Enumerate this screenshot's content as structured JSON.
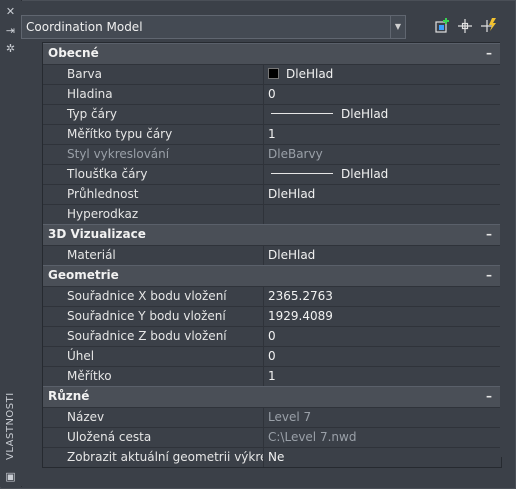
{
  "side": {
    "title": "VLASTNOSTI",
    "icons": [
      "close-icon",
      "autohide-icon",
      "settings-icon",
      "properties-icon"
    ]
  },
  "toolbar": {
    "selection": "Coordination Model"
  },
  "sections": [
    {
      "title": "Obecné",
      "rows": [
        {
          "name": "Barva",
          "value": "DleHlad",
          "kind": "color"
        },
        {
          "name": "Hladina",
          "value": "0"
        },
        {
          "name": "Typ čáry",
          "value": "DleHlad",
          "kind": "line"
        },
        {
          "name": "Měřítko typu čáry",
          "value": "1"
        },
        {
          "name": "Styl vykreslování",
          "value": "DleBarvy",
          "dim": true
        },
        {
          "name": "Tloušťka čáry",
          "value": "DleHlad",
          "kind": "line"
        },
        {
          "name": "Průhlednost",
          "value": "DleHlad"
        },
        {
          "name": "Hyperodkaz",
          "value": ""
        }
      ]
    },
    {
      "title": "3D Vizualizace",
      "rows": [
        {
          "name": "Materiál",
          "value": "DleHlad"
        }
      ]
    },
    {
      "title": "Geometrie",
      "rows": [
        {
          "name": "Souřadnice X bodu vložení",
          "value": "2365.2763"
        },
        {
          "name": "Souřadnice Y bodu vložení",
          "value": "1929.4089"
        },
        {
          "name": "Souřadnice Z bodu vložení",
          "value": "0"
        },
        {
          "name": "Úhel",
          "value": "0"
        },
        {
          "name": "Měřítko",
          "value": "1"
        }
      ]
    },
    {
      "title": "Různé",
      "rows": [
        {
          "name": "Název",
          "value": "Level 7",
          "dim_value": true
        },
        {
          "name": "Uložená cesta",
          "value": "C:\\Level 7.nwd",
          "dim_value": true
        },
        {
          "name": "Zobrazit aktuální geometrii výkresu",
          "value": "Ne"
        }
      ]
    }
  ],
  "collapse_symbol": "–"
}
